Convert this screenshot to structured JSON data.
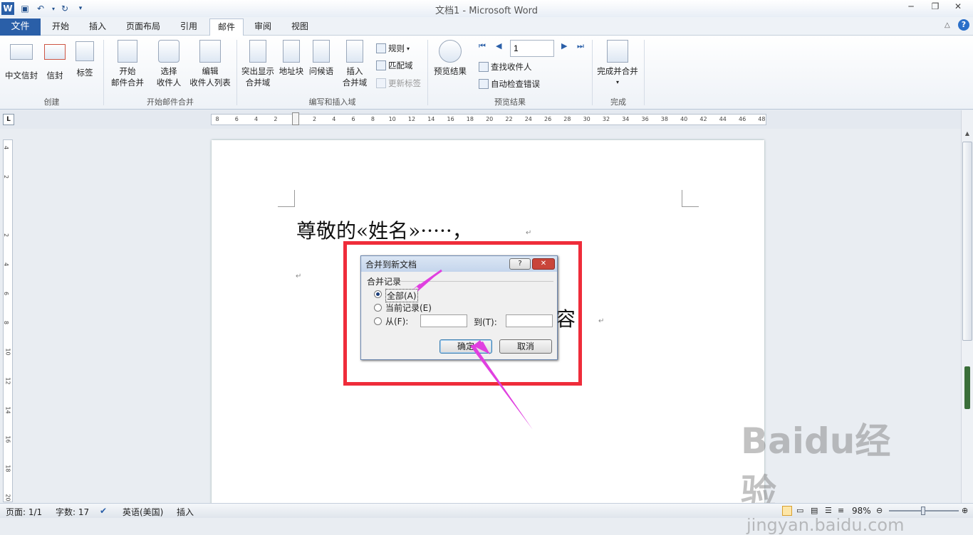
{
  "titlebar": {
    "title": "文档1 - Microsoft Word"
  },
  "tabs": {
    "file": "文件",
    "items": [
      "开始",
      "插入",
      "页面布局",
      "引用",
      "邮件",
      "审阅",
      "视图"
    ],
    "active_index": 4
  },
  "ribbon": {
    "create": {
      "group": "创建",
      "cn_envelope": "中文信封",
      "envelope": "信封",
      "labels": "标签"
    },
    "start_merge": {
      "group": "开始邮件合并",
      "start": [
        "开始",
        "邮件合并"
      ],
      "select": [
        "选择",
        "收件人"
      ],
      "edit": [
        "编辑",
        "收件人列表"
      ]
    },
    "write_insert": {
      "group": "编写和插入域",
      "highlight": [
        "突出显示",
        "合并域"
      ],
      "address": "地址块",
      "greeting": "问候语",
      "insert_field": [
        "插入",
        "合并域"
      ],
      "rules": "规则",
      "match": "匹配域",
      "update": "更新标签"
    },
    "preview": {
      "group": "预览结果",
      "preview_btn": "预览结果",
      "record": "1",
      "find": "查找收件人",
      "check": "自动检查错误"
    },
    "finish": {
      "group": "完成",
      "finish_btn": "完成并合并"
    }
  },
  "ruler": {
    "h_ticks": [
      "8",
      "6",
      "4",
      "2",
      "",
      "2",
      "4",
      "6",
      "8",
      "10",
      "12",
      "14",
      "16",
      "18",
      "20",
      "22",
      "24",
      "26",
      "28",
      "30",
      "32",
      "34",
      "36",
      "38",
      "40",
      "42",
      "44",
      "46",
      "48"
    ],
    "v_ticks": [
      "4",
      "2",
      "",
      "2",
      "4",
      "6",
      "8",
      "10",
      "12",
      "14",
      "16",
      "18",
      "20"
    ]
  },
  "document": {
    "line1": "尊敬的«姓名»·····，",
    "line2": "容"
  },
  "dialog": {
    "title": "合并到新文档",
    "section": "合并记录",
    "opt_all": "全部(A)",
    "opt_current": "当前记录(E)",
    "opt_from": "从(F):",
    "to_label": "到(T):",
    "ok": "确定",
    "cancel": "取消"
  },
  "status": {
    "page": "页面: 1/1",
    "words": "字数: 17",
    "lang": "英语(美国)",
    "mode": "插入",
    "zoom": "98%"
  },
  "watermark": {
    "brand": "Baidu经验",
    "url": "jingyan.baidu.com"
  },
  "colors": {
    "highlight_box": "#ef2c3a",
    "arrow": "#e040e0",
    "file_tab": "#2a5fa8"
  }
}
